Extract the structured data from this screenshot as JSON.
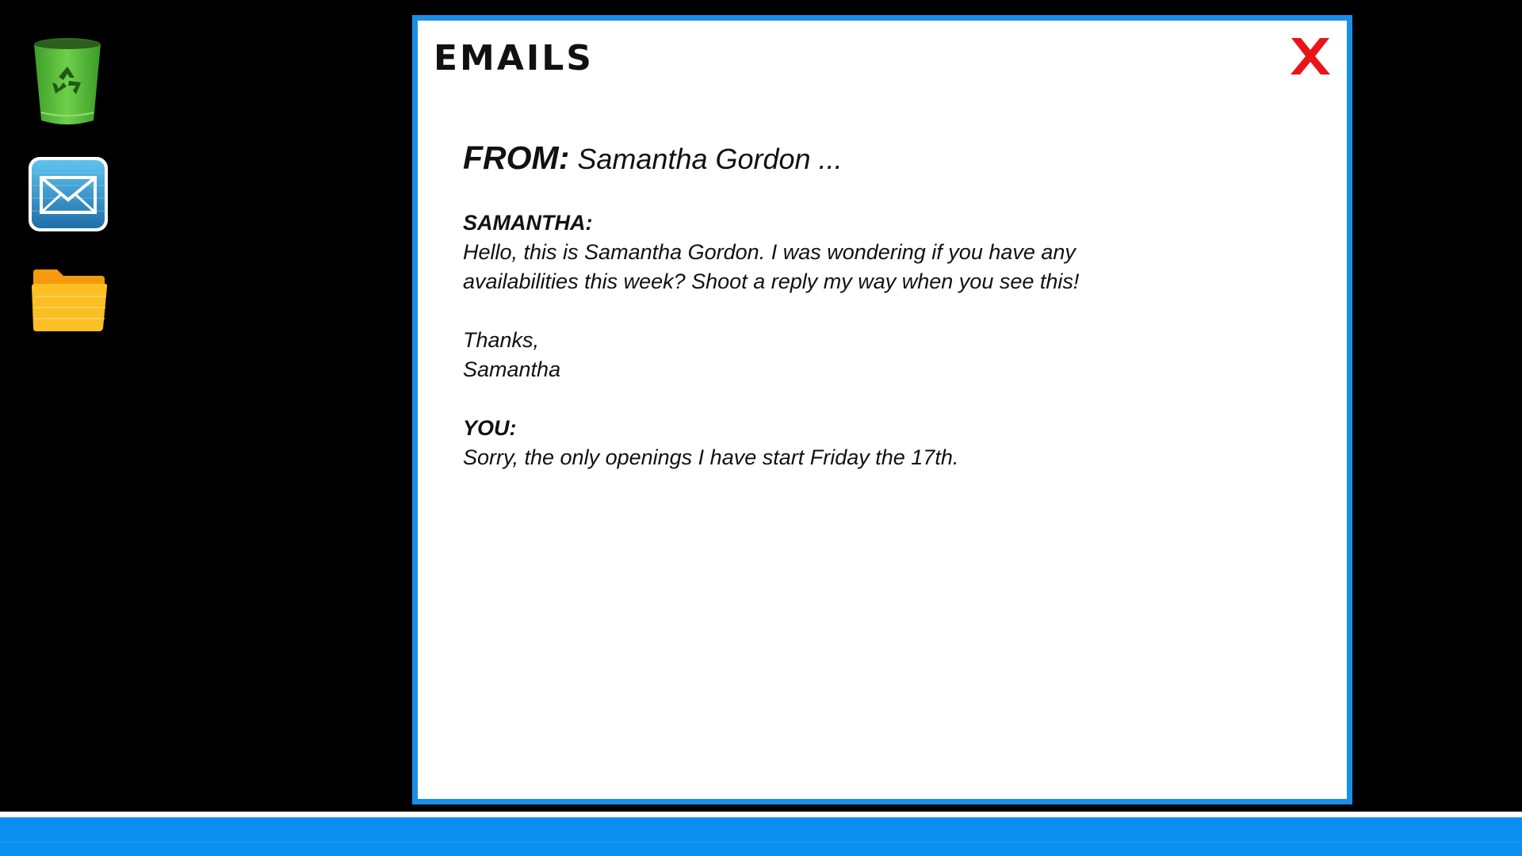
{
  "desktop": {
    "icons": [
      {
        "name": "recycle-bin",
        "icon": "trash-icon"
      },
      {
        "name": "email",
        "icon": "mail-icon"
      },
      {
        "name": "files",
        "icon": "folder-icon"
      }
    ]
  },
  "window": {
    "title": "EMAILS",
    "close_icon": "close-icon",
    "accent_color": "#1a8fe8",
    "close_color": "#e8141a"
  },
  "email": {
    "from_label": "FROM:",
    "from_name": "Samantha Gordon ...",
    "messages": [
      {
        "speaker": "SAMANTHA:",
        "lines": [
          "Hello, this is Samantha Gordon. I was wondering if you have any",
          "availabilities this week? Shoot a reply my way when you see this!"
        ],
        "signoff": [
          "Thanks,",
          "Samantha"
        ]
      },
      {
        "speaker": "YOU:",
        "lines": [
          "Sorry, the only openings I have start Friday the 17th."
        ]
      }
    ]
  },
  "taskbar": {
    "color": "#0a8ff0"
  }
}
